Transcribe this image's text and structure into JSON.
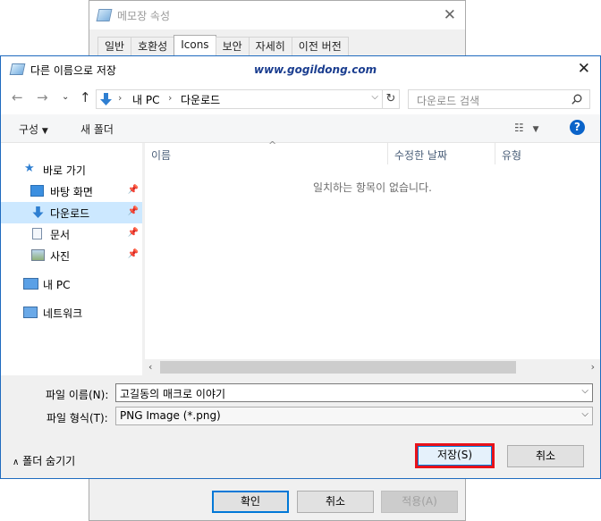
{
  "background_window": {
    "title": "메모장 속성",
    "tabs": [
      "일반",
      "호환성",
      "Icons",
      "보안",
      "자세히",
      "이전 버전"
    ],
    "active_tab": "Icons",
    "buttons": {
      "ok": "확인",
      "cancel": "취소",
      "apply": "적용(A)"
    }
  },
  "dialog": {
    "title": "다른 이름으로 저장",
    "watermark": "www.gogildong.com",
    "address": {
      "root": "내 PC",
      "current": "다운로드"
    },
    "search": {
      "placeholder": "다운로드 검색"
    },
    "toolbar": {
      "organize": "구성",
      "new_folder": "새 폴더"
    },
    "sidebar": {
      "quick_access": "바로 가기",
      "items": [
        "바탕 화면",
        "다운로드",
        "문서",
        "사진"
      ],
      "selected": "다운로드",
      "this_pc": "내 PC",
      "network": "네트워크"
    },
    "columns": [
      "이름",
      "수정한 날짜",
      "유형"
    ],
    "empty_message": "일치하는 항목이 없습니다.",
    "filename": {
      "label": "파일 이름(N):",
      "value": "고길동의 매크로 이야기"
    },
    "filetype": {
      "label": "파일 형식(T):",
      "value": "PNG Image (*.png)"
    },
    "hide_folders": "폴더 숨기기",
    "buttons": {
      "save": "저장(S)",
      "cancel": "취소"
    }
  },
  "colors": {
    "accent": "#0078d7",
    "selection": "#cce8ff",
    "highlight_box": "#e8121a",
    "help": "#0a63c9"
  }
}
